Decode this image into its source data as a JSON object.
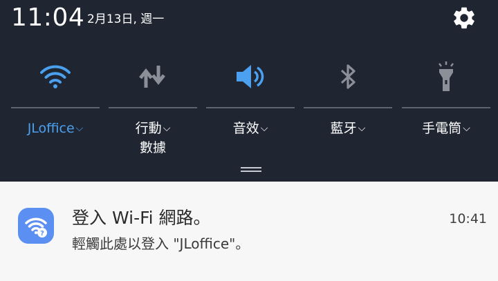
{
  "status_bar": {
    "time": "11:04",
    "date": "2月13日, 週一",
    "settings_icon": "gear-icon"
  },
  "quick_settings": {
    "tiles": [
      {
        "label": "JLoffice",
        "icon": "wifi-icon",
        "active": true,
        "accent": "#4ba0f0"
      },
      {
        "label": "行動",
        "label2": "數據",
        "icon": "mobile-data-icon",
        "active": false
      },
      {
        "label": "音效",
        "icon": "volume-icon",
        "active": true
      },
      {
        "label": "藍牙",
        "icon": "bluetooth-icon",
        "active": false
      },
      {
        "label": "手電筒",
        "icon": "flashlight-icon",
        "active": false
      }
    ],
    "chevron": "⌵"
  },
  "notification": {
    "title": "登入 Wi-Fi 網路。",
    "body": "輕觸此處以登入 \"JLoffice\"。",
    "time": "10:41",
    "icon": "wifi-question-icon",
    "icon_color": "#5b8ff2"
  }
}
